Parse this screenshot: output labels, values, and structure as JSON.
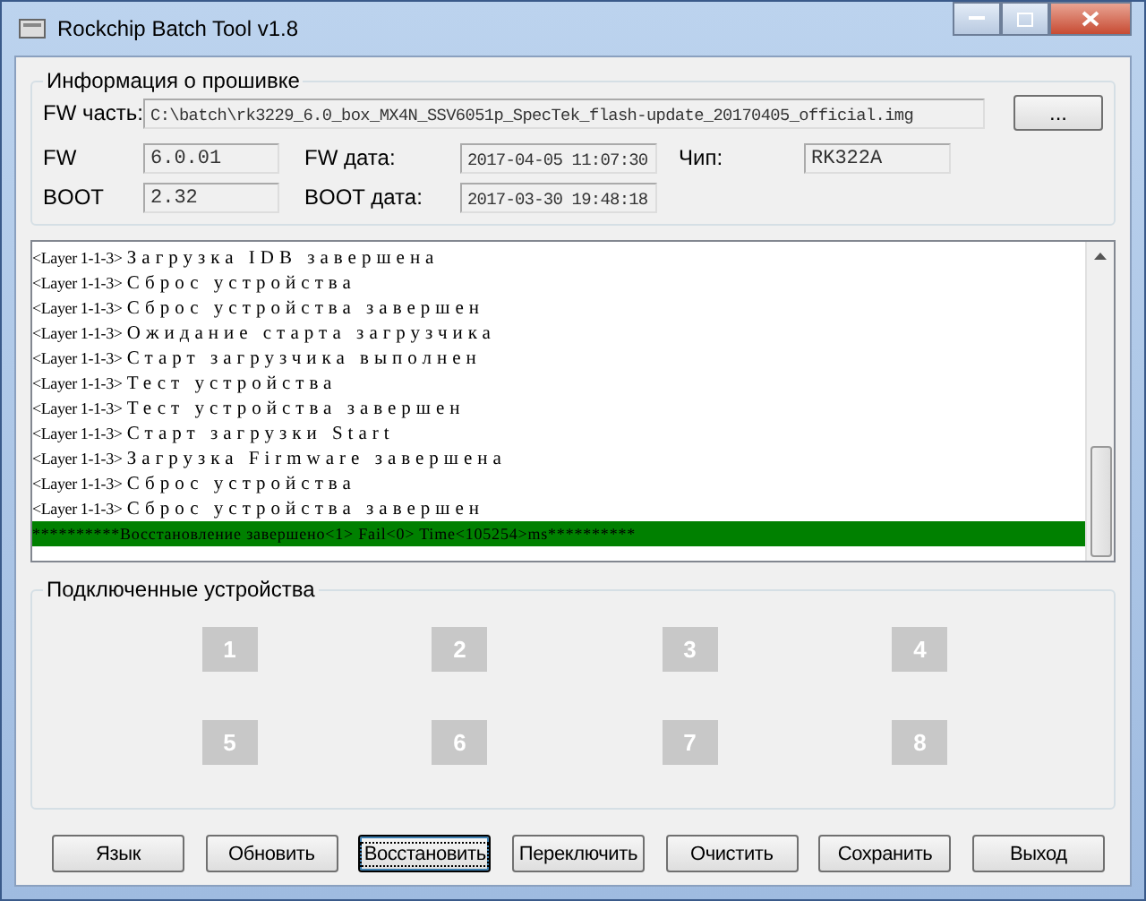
{
  "window": {
    "title": "Rockchip Batch Tool v1.8"
  },
  "firmware_info": {
    "title": "Информация о прошивке",
    "fw_part_label": "FW часть:",
    "fw_part_value": "C:\\batch\\rk3229_6.0_box_MX4N_SSV6051p_SpecTek_flash-update_20170405_official.img",
    "browse_button": "...",
    "fw_label": "FW",
    "fw_value": "6.0.01",
    "fw_date_label": "FW дата:",
    "fw_date_value": "2017-04-05 11:07:30",
    "chip_label": "Чип:",
    "chip_value": "RK322A",
    "boot_label": "BOOT",
    "boot_value": "2.32",
    "boot_date_label": "BOOT дата:",
    "boot_date_value": "2017-03-30 19:48:18"
  },
  "log": [
    {
      "kind": "line",
      "prefix": "<Layer 1-1-3>",
      "text": "Загрузка IDB завершена"
    },
    {
      "kind": "line",
      "prefix": "<Layer 1-1-3>",
      "text": "Сброс устройства"
    },
    {
      "kind": "line",
      "prefix": "<Layer 1-1-3>",
      "text": "Сброс устройства завершен"
    },
    {
      "kind": "line",
      "prefix": "<Layer 1-1-3>",
      "text": "Ожидание старта загрузчика"
    },
    {
      "kind": "line",
      "prefix": "<Layer 1-1-3>",
      "text": "Старт загрузчика выполнен"
    },
    {
      "kind": "line",
      "prefix": "<Layer 1-1-3>",
      "text": "Тест устройства"
    },
    {
      "kind": "line",
      "prefix": "<Layer 1-1-3>",
      "text": "Тест устройства завершен"
    },
    {
      "kind": "line",
      "prefix": "<Layer 1-1-3>",
      "text": "Старт загрузки Start"
    },
    {
      "kind": "line",
      "prefix": "<Layer 1-1-3>",
      "text": "Загрузка Firmware завершена"
    },
    {
      "kind": "line",
      "prefix": "<Layer 1-1-3>",
      "text": "Сброс устройства"
    },
    {
      "kind": "line",
      "prefix": "<Layer 1-1-3>",
      "text": "Сброс устройства завершен"
    },
    {
      "kind": "summary",
      "text": "**********Восстановление завершено<1> Fail<0> Time<105254>ms**********"
    }
  ],
  "devices": {
    "title": "Подключенные устройства",
    "slots": [
      "1",
      "2",
      "3",
      "4",
      "5",
      "6",
      "7",
      "8"
    ]
  },
  "buttons": [
    {
      "label": "Язык",
      "focused": false
    },
    {
      "label": "Обновить",
      "focused": false
    },
    {
      "label": "Восстановить",
      "focused": true
    },
    {
      "label": "Переключить",
      "focused": false
    },
    {
      "label": "Очистить",
      "focused": false
    },
    {
      "label": "Сохранить",
      "focused": false
    },
    {
      "label": "Выход",
      "focused": false
    }
  ]
}
